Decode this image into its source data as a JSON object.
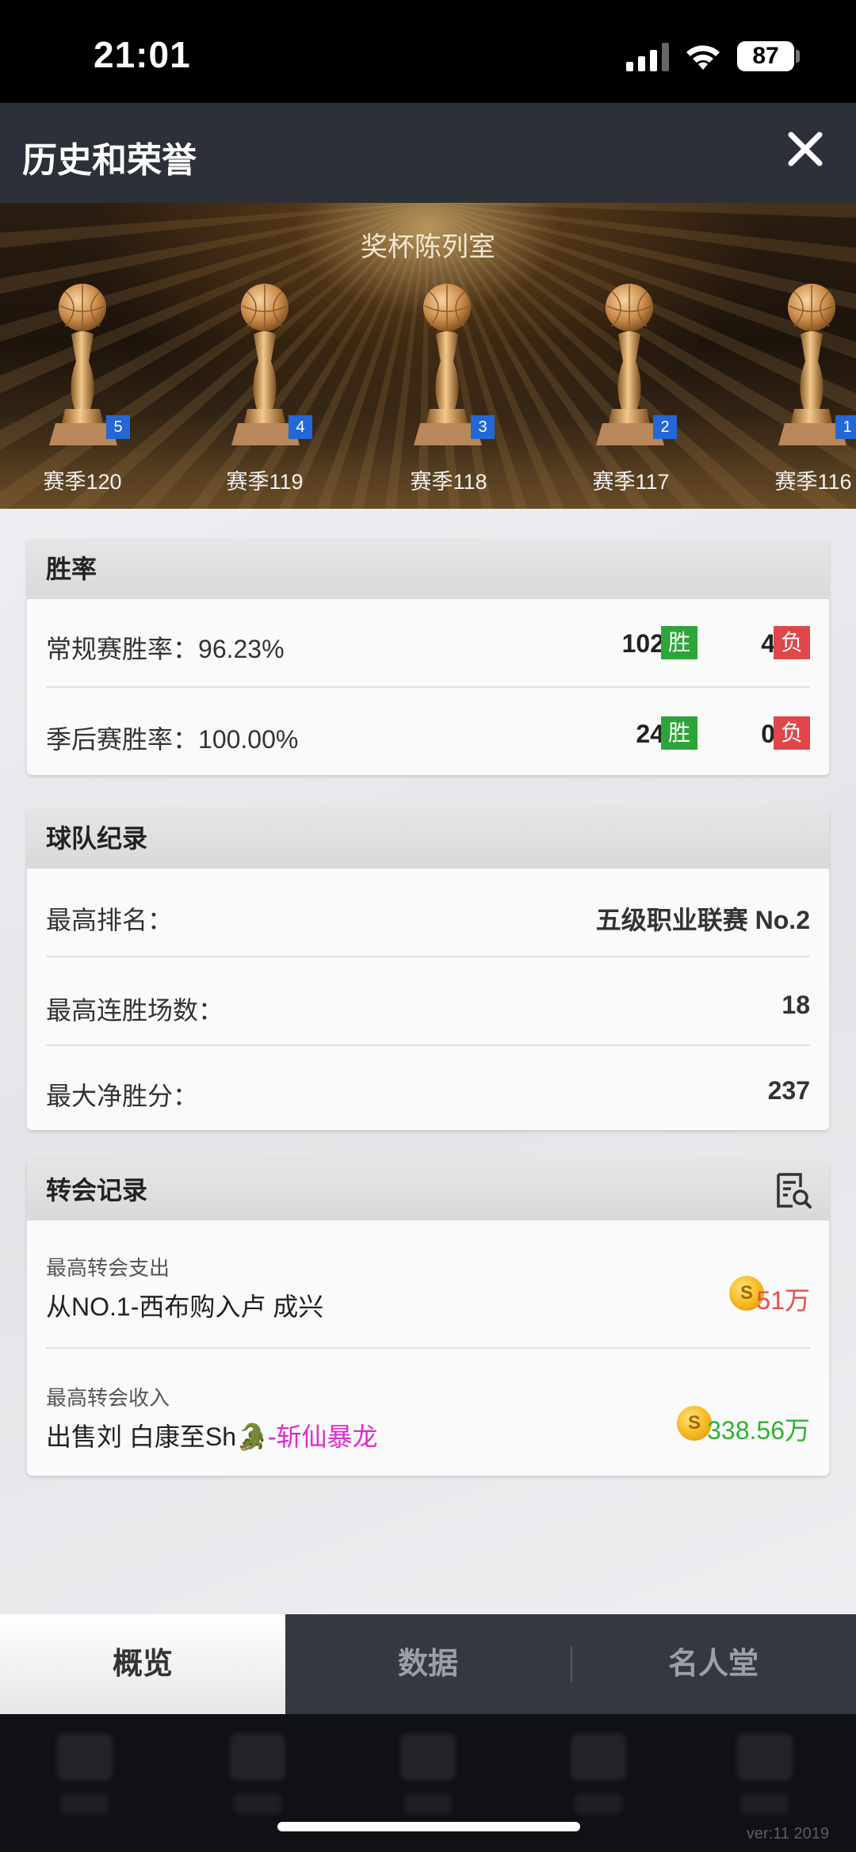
{
  "status": {
    "time": "21:01",
    "battery": "87"
  },
  "header": {
    "title": "历史和荣誉"
  },
  "banner": {
    "title": "奖杯陈列室",
    "trophies": [
      {
        "badge": "5",
        "season": "赛季120"
      },
      {
        "badge": "4",
        "season": "赛季119"
      },
      {
        "badge": "3",
        "season": "赛季118"
      },
      {
        "badge": "2",
        "season": "赛季117"
      },
      {
        "badge": "1",
        "season": "赛季116"
      }
    ]
  },
  "winrate": {
    "title": "胜率",
    "win_tag": "胜",
    "loss_tag": "负",
    "rows": [
      {
        "label": "常规赛胜率：",
        "value": "96.23%",
        "wins": "102",
        "losses": "4"
      },
      {
        "label": "季后赛胜率：",
        "value": "100.00%",
        "wins": "24",
        "losses": "0"
      }
    ]
  },
  "team_record": {
    "title": "球队纪录",
    "rows": [
      {
        "label": "最高排名：",
        "value": "五级职业联赛 No.2"
      },
      {
        "label": "最高连胜场数：",
        "value": "18"
      },
      {
        "label": "最大净胜分：",
        "value": "237"
      }
    ]
  },
  "transfer": {
    "title": "转会记录",
    "rows": [
      {
        "label": "最高转会支出",
        "text": "从NO.1-西布购入卢 成兴",
        "amount": "51万",
        "coin": "S"
      },
      {
        "label": "最高转会收入",
        "text": "出售刘 白康至Sh",
        "emoji": "🐊",
        "highlight": "-斩仙暴龙",
        "amount": "338.56万",
        "coin": "S"
      }
    ]
  },
  "tabs": [
    {
      "label": "概览"
    },
    {
      "label": "数据"
    },
    {
      "label": "名人堂"
    }
  ],
  "footer": {
    "version": "ver:11  2019"
  },
  "colors": {
    "title_bar": "#2c3038",
    "win": "#2ca53a",
    "loss": "#e0464a",
    "expense": "#e5504b",
    "income": "#2eb32f",
    "highlight": "#e02ad0"
  }
}
